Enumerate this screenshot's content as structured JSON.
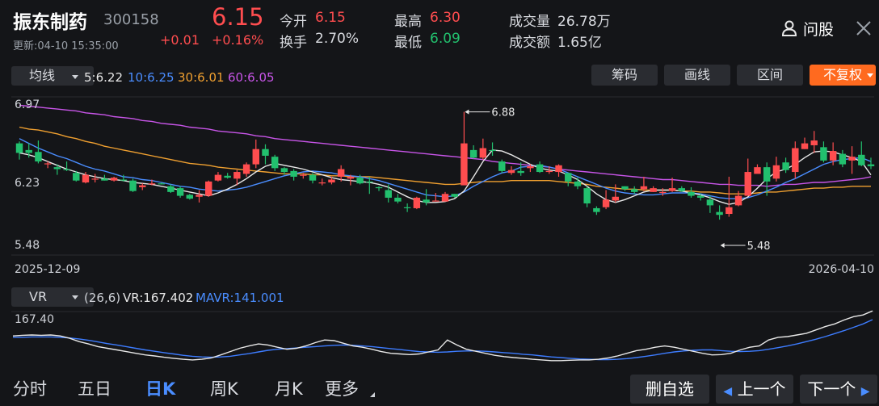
{
  "header": {
    "stock_name": "振东制药",
    "stock_code": "300158",
    "price": "6.15",
    "change": "+0.01",
    "change_pct": "+0.16%",
    "updated": "更新:04-10 15:35:00",
    "open_label": "今开",
    "open_value": "6.15",
    "turnover_label": "换手",
    "turnover_value": "2.70%",
    "high_label": "最高",
    "high_value": "6.30",
    "low_label": "最低",
    "low_value": "6.09",
    "volume_label": "成交量",
    "volume_value": "26.78万",
    "amount_label": "成交额",
    "amount_value": "1.65亿",
    "ask_label": "问股"
  },
  "indicator_bar": {
    "main_indicator": "均线",
    "ma5": "5:6.22",
    "ma10": "10:6.25",
    "ma30": "30:6.01",
    "ma60": "60:6.05",
    "buttons": [
      "筹码",
      "画线",
      "区间",
      "不复权"
    ]
  },
  "colors": {
    "up": "#ff4d4f",
    "down": "#22c06e",
    "ma5": "#e8e8e8",
    "ma10": "#4a8dff",
    "ma30": "#f0a030",
    "ma60": "#c855e8",
    "vr": "#e8e8e8",
    "mavr": "#3d7cff",
    "accent": "#ff6a1f"
  },
  "chart_data": {
    "type": "candlestick",
    "price_axis_labels": [
      "6.97",
      "6.23",
      "5.48"
    ],
    "ylim": [
      5.48,
      6.97
    ],
    "x_start_label": "2025-12-09",
    "x_end_label": "2026-04-10",
    "annotations": [
      {
        "label": "6.88",
        "value": 6.88,
        "index": 47
      },
      {
        "label": "5.48",
        "value": 5.48,
        "index": 74
      }
    ],
    "candles": [
      [
        6.55,
        6.45,
        6.57,
        6.38
      ],
      [
        6.48,
        6.45,
        6.55,
        6.4
      ],
      [
        6.46,
        6.36,
        6.58,
        6.34
      ],
      [
        6.34,
        6.34,
        6.36,
        6.29
      ],
      [
        6.3,
        6.28,
        6.33,
        6.22
      ],
      [
        6.28,
        6.27,
        6.36,
        6.26
      ],
      [
        6.24,
        6.16,
        6.26,
        6.15
      ],
      [
        6.14,
        6.22,
        6.25,
        6.13
      ],
      [
        6.18,
        6.18,
        6.23,
        6.14
      ],
      [
        6.18,
        6.16,
        6.22,
        6.16
      ],
      [
        6.16,
        6.19,
        6.2,
        6.15
      ],
      [
        6.17,
        6.16,
        6.22,
        6.15
      ],
      [
        6.16,
        6.05,
        6.18,
        6.04
      ],
      [
        6.09,
        6.11,
        6.13,
        6.06
      ],
      [
        6.12,
        6.13,
        6.17,
        6.11
      ],
      [
        6.13,
        6.12,
        6.14,
        6.12
      ],
      [
        6.1,
        6.04,
        6.12,
        6.03
      ],
      [
        6.08,
        6.0,
        6.1,
        5.98
      ],
      [
        6.01,
        5.97,
        6.02,
        5.96
      ],
      [
        5.99,
        6.01,
        6.06,
        5.93
      ],
      [
        6.0,
        6.15,
        6.16,
        5.99
      ],
      [
        6.16,
        6.22,
        6.25,
        6.15
      ],
      [
        6.21,
        6.19,
        6.24,
        6.18
      ],
      [
        6.18,
        6.25,
        6.27,
        6.11
      ],
      [
        6.23,
        6.33,
        6.35,
        6.2
      ],
      [
        6.33,
        6.49,
        6.59,
        6.29
      ],
      [
        6.49,
        6.42,
        6.54,
        6.33
      ],
      [
        6.41,
        6.29,
        6.43,
        6.26
      ],
      [
        6.29,
        6.25,
        6.3,
        6.22
      ],
      [
        6.26,
        6.2,
        6.28,
        6.16
      ],
      [
        6.21,
        6.22,
        6.24,
        6.18
      ],
      [
        6.22,
        6.16,
        6.24,
        6.13
      ],
      [
        6.14,
        6.14,
        6.18,
        6.11
      ],
      [
        6.14,
        6.17,
        6.2,
        6.12
      ],
      [
        6.2,
        6.28,
        6.32,
        6.15
      ],
      [
        6.18,
        6.2,
        6.22,
        6.11
      ],
      [
        6.19,
        6.13,
        6.22,
        6.12
      ],
      [
        6.15,
        6.14,
        6.2,
        6.02
      ],
      [
        6.09,
        6.08,
        6.1,
        6.05
      ],
      [
        6.06,
        5.98,
        6.12,
        5.93
      ],
      [
        5.98,
        5.94,
        6.02,
        5.92
      ],
      [
        5.88,
        5.87,
        5.92,
        5.83
      ],
      [
        5.87,
        5.98,
        5.99,
        5.86
      ],
      [
        5.96,
        5.93,
        6.07,
        5.9
      ],
      [
        5.94,
        5.95,
        6.03,
        5.95
      ],
      [
        5.94,
        6.02,
        6.04,
        5.94
      ],
      [
        6.02,
        5.99,
        6.02,
        5.98
      ],
      [
        6.11,
        6.55,
        6.88,
        6.46
      ],
      [
        6.48,
        6.4,
        6.53,
        6.39
      ],
      [
        6.4,
        6.5,
        6.6,
        6.38
      ],
      [
        6.48,
        6.47,
        6.56,
        6.42
      ],
      [
        6.36,
        6.26,
        6.38,
        6.24
      ],
      [
        6.24,
        6.27,
        6.31,
        6.22
      ],
      [
        6.26,
        6.24,
        6.35,
        6.21
      ],
      [
        6.29,
        6.31,
        6.33,
        6.25
      ],
      [
        6.33,
        6.25,
        6.36,
        6.24
      ],
      [
        6.25,
        6.26,
        6.31,
        6.23
      ],
      [
        6.25,
        6.32,
        6.33,
        6.2
      ],
      [
        6.24,
        6.15,
        6.22,
        6.1
      ],
      [
        6.15,
        6.1,
        6.19,
        6.07
      ],
      [
        6.08,
        5.92,
        6.1,
        5.88
      ],
      [
        5.87,
        5.83,
        5.89,
        5.8
      ],
      [
        5.88,
        5.96,
        6.06,
        5.86
      ],
      [
        5.95,
        5.99,
        6.12,
        5.93
      ],
      [
        6.1,
        6.07,
        6.1,
        6.05
      ],
      [
        6.07,
        6.04,
        6.1,
        6.02
      ],
      [
        6.07,
        6.1,
        6.2,
        6.05
      ],
      [
        6.04,
        6.08,
        6.1,
        6.04
      ],
      [
        6.03,
        6.04,
        6.08,
        6.0
      ],
      [
        6.05,
        6.08,
        6.19,
        6.04
      ],
      [
        6.08,
        6.05,
        6.1,
        6.04
      ],
      [
        6.04,
        6.0,
        6.09,
        5.98
      ],
      [
        6.0,
        5.98,
        6.02,
        5.95
      ],
      [
        5.96,
        5.9,
        6.0,
        5.82
      ],
      [
        5.83,
        5.8,
        5.9,
        5.75
      ],
      [
        5.81,
        5.88,
        6.2,
        5.78
      ],
      [
        5.9,
        6.0,
        6.05,
        5.89
      ],
      [
        6.0,
        6.25,
        6.39,
        6.22
      ],
      [
        6.23,
        6.3,
        6.33,
        6.25
      ],
      [
        6.3,
        6.15,
        6.35,
        6.0
      ],
      [
        6.18,
        6.32,
        6.41,
        6.15
      ],
      [
        6.35,
        6.27,
        6.4,
        6.24
      ],
      [
        6.25,
        6.5,
        6.57,
        6.18
      ],
      [
        6.49,
        6.55,
        6.61,
        6.49
      ],
      [
        6.53,
        6.58,
        6.68,
        6.45
      ],
      [
        6.51,
        6.37,
        6.57,
        6.35
      ],
      [
        6.37,
        6.47,
        6.56,
        6.32
      ],
      [
        6.44,
        6.33,
        6.48,
        6.3
      ],
      [
        6.37,
        6.41,
        6.52,
        6.23
      ],
      [
        6.43,
        6.32,
        6.57,
        6.31
      ],
      [
        6.33,
        6.31,
        6.4,
        6.28
      ]
    ],
    "ma_series": [
      {
        "name": "5",
        "values": [
          6.45,
          6.43,
          6.4,
          6.36,
          6.32,
          6.28,
          6.25,
          6.22,
          6.2,
          6.18,
          6.17,
          6.16,
          6.14,
          6.13,
          6.12,
          6.1,
          6.08,
          6.06,
          6.04,
          6.02,
          6.0,
          6.03,
          6.07,
          6.12,
          6.18,
          6.25,
          6.31,
          6.34,
          6.32,
          6.3,
          6.28,
          6.25,
          6.22,
          6.19,
          6.17,
          6.16,
          6.15,
          6.14,
          6.12,
          6.09,
          6.04,
          5.99,
          5.95,
          5.93,
          5.93,
          5.94,
          5.97,
          6.05,
          6.2,
          6.36,
          6.48,
          6.47,
          6.43,
          6.38,
          6.33,
          6.29,
          6.27,
          6.26,
          6.22,
          6.17,
          6.1,
          6.02,
          5.96,
          5.93,
          5.96,
          6.0,
          6.04,
          6.06,
          6.06,
          6.06,
          6.05,
          6.03,
          6.01,
          5.98,
          5.94,
          5.91,
          5.93,
          5.99,
          6.08,
          6.18,
          6.25,
          6.28,
          6.33,
          6.4,
          6.46,
          6.47,
          6.46,
          6.43,
          6.4,
          6.36,
          6.22
        ]
      },
      {
        "name": "10",
        "values": [
          6.6,
          6.55,
          6.5,
          6.46,
          6.42,
          6.39,
          6.35,
          6.31,
          6.28,
          6.26,
          6.23,
          6.2,
          6.19,
          6.17,
          6.16,
          6.14,
          6.12,
          6.1,
          6.09,
          6.07,
          6.06,
          6.05,
          6.06,
          6.07,
          6.09,
          6.12,
          6.15,
          6.18,
          6.21,
          6.23,
          6.25,
          6.26,
          6.25,
          6.24,
          6.22,
          6.21,
          6.2,
          6.18,
          6.16,
          6.13,
          6.1,
          6.07,
          6.04,
          6.01,
          6.0,
          5.99,
          6.0,
          6.04,
          6.1,
          6.15,
          6.2,
          6.24,
          6.26,
          6.3,
          6.31,
          6.32,
          6.3,
          6.28,
          6.24,
          6.2,
          6.16,
          6.12,
          6.08,
          6.05,
          6.03,
          6.02,
          6.01,
          6.01,
          6.02,
          6.03,
          6.03,
          6.03,
          6.02,
          6.0,
          5.98,
          5.97,
          5.97,
          5.98,
          6.01,
          6.05,
          6.09,
          6.14,
          6.18,
          6.23,
          6.28,
          6.33,
          6.36,
          6.38,
          6.39,
          6.4,
          6.36
        ]
      },
      {
        "name": "30",
        "values": [
          6.72,
          6.7,
          6.69,
          6.67,
          6.65,
          6.62,
          6.6,
          6.57,
          6.55,
          6.52,
          6.5,
          6.48,
          6.46,
          6.44,
          6.42,
          6.4,
          6.38,
          6.36,
          6.34,
          6.33,
          6.32,
          6.3,
          6.29,
          6.28,
          6.27,
          6.26,
          6.25,
          6.24,
          6.23,
          6.23,
          6.23,
          6.22,
          6.22,
          6.21,
          6.21,
          6.2,
          6.2,
          6.2,
          6.19,
          6.18,
          6.17,
          6.16,
          6.15,
          6.14,
          6.13,
          6.12,
          6.12,
          6.13,
          6.14,
          6.15,
          6.15,
          6.15,
          6.16,
          6.16,
          6.16,
          6.16,
          6.16,
          6.15,
          6.14,
          6.13,
          6.12,
          6.1,
          6.09,
          6.08,
          6.07,
          6.07,
          6.06,
          6.06,
          6.06,
          6.06,
          6.05,
          6.05,
          6.04,
          6.04,
          6.03,
          6.02,
          6.02,
          6.02,
          6.03,
          6.04,
          6.04,
          6.05,
          6.06,
          6.07,
          6.08,
          6.08,
          6.09,
          6.09,
          6.1,
          6.1,
          6.1
        ]
      },
      {
        "name": "60",
        "values": [
          6.95,
          6.94,
          6.93,
          6.92,
          6.91,
          6.9,
          6.89,
          6.87,
          6.86,
          6.85,
          6.83,
          6.82,
          6.81,
          6.79,
          6.78,
          6.76,
          6.75,
          6.74,
          6.72,
          6.71,
          6.7,
          6.68,
          6.67,
          6.66,
          6.65,
          6.63,
          6.62,
          6.6,
          6.59,
          6.58,
          6.57,
          6.56,
          6.55,
          6.54,
          6.53,
          6.52,
          6.51,
          6.5,
          6.49,
          6.48,
          6.47,
          6.46,
          6.45,
          6.44,
          6.43,
          6.42,
          6.41,
          6.4,
          6.39,
          6.38,
          6.36,
          6.35,
          6.34,
          6.33,
          6.32,
          6.31,
          6.3,
          6.28,
          6.27,
          6.26,
          6.25,
          6.24,
          6.23,
          6.22,
          6.21,
          6.2,
          6.19,
          6.18,
          6.17,
          6.17,
          6.16,
          6.15,
          6.14,
          6.13,
          6.12,
          6.12,
          6.11,
          6.11,
          6.11,
          6.1,
          6.11,
          6.12,
          6.12,
          6.13,
          6.14,
          6.14,
          6.15,
          6.16,
          6.17,
          6.18,
          6.2
        ]
      }
    ]
  },
  "vr_panel": {
    "name": "VR",
    "params": "(26,6)",
    "vr_text": "VR:167.402",
    "mavr_text": "MAVR:141.001",
    "top_label": "167.40",
    "vr_values": [
      92,
      94,
      95,
      94,
      95,
      92,
      85,
      75,
      68,
      60,
      55,
      50,
      45,
      40,
      35,
      32,
      28,
      25,
      22,
      20,
      22,
      26,
      35,
      45,
      55,
      62,
      68,
      65,
      58,
      52,
      55,
      62,
      72,
      80,
      78,
      70,
      62,
      58,
      52,
      45,
      40,
      38,
      36,
      38,
      44,
      50,
      80,
      65,
      52,
      46,
      40,
      34,
      30,
      27,
      25,
      22,
      20,
      18,
      18,
      19,
      20,
      20,
      22,
      26,
      32,
      40,
      48,
      52,
      58,
      62,
      58,
      52,
      46,
      40,
      35,
      36,
      40,
      50,
      58,
      62,
      80,
      88,
      90,
      95,
      100,
      110,
      120,
      128,
      140,
      150,
      155,
      167
    ],
    "mavr_values": [
      88,
      88,
      89,
      89,
      89,
      88,
      86,
      83,
      79,
      74,
      69,
      65,
      60,
      55,
      50,
      46,
      42,
      38,
      34,
      31,
      29,
      28,
      29,
      31,
      35,
      39,
      44,
      49,
      52,
      54,
      56,
      58,
      60,
      62,
      64,
      65,
      64,
      62,
      60,
      57,
      54,
      51,
      48,
      45,
      44,
      43,
      44,
      46,
      47,
      47,
      46,
      44,
      42,
      40,
      37,
      35,
      32,
      29,
      27,
      25,
      23,
      22,
      21,
      21,
      22,
      24,
      27,
      31,
      35,
      40,
      44,
      47,
      49,
      50,
      50,
      48,
      46,
      45,
      46,
      48,
      52,
      57,
      62,
      68,
      75,
      82,
      90,
      99,
      108,
      118,
      128,
      141
    ]
  },
  "bottom_tabs": [
    "分时",
    "五日",
    "日K",
    "周K",
    "月K",
    "更多"
  ],
  "bottom_actions": {
    "delete_watch": "删自选",
    "prev": "上一个",
    "next": "下一个"
  }
}
